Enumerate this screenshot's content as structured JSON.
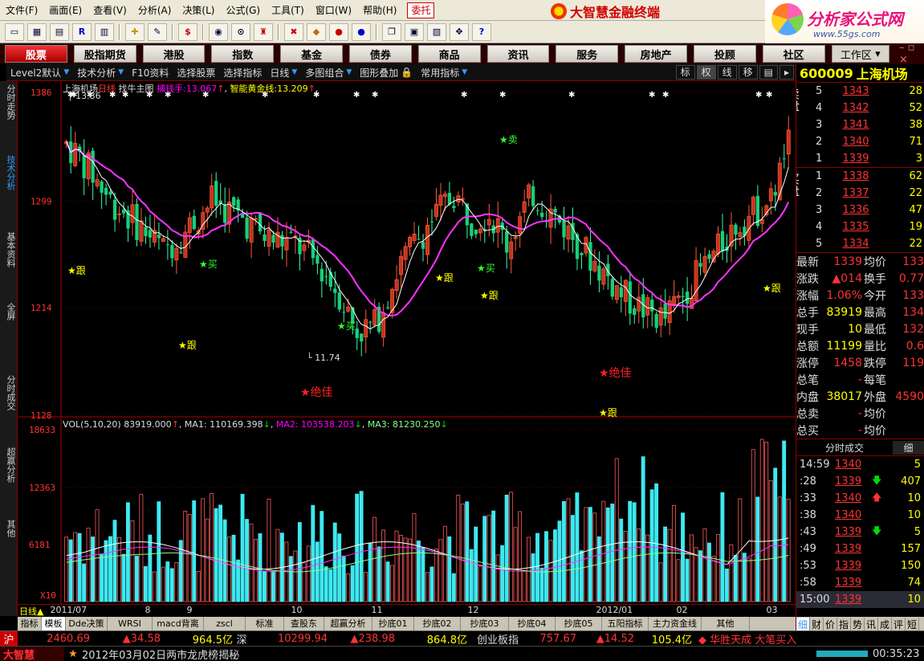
{
  "menu": [
    "文件(F)",
    "画面(E)",
    "查看(V)",
    "分析(A)",
    "决策(L)",
    "公式(G)",
    "工具(T)",
    "窗口(W)",
    "帮助(H)"
  ],
  "weituo": "委托",
  "brand": "大智慧金融终端",
  "site_logo": {
    "title": "分析家公式网",
    "url": "www.55gs.com"
  },
  "categories": [
    "股票",
    "股指期货",
    "港股",
    "指数",
    "基金",
    "债券",
    "商品",
    "资讯",
    "服务",
    "房地产",
    "投顾",
    "社区"
  ],
  "work_zone": "工作区",
  "subbar": {
    "items": [
      "Level2默认",
      "技术分析",
      "F10资料",
      "选择股票",
      "选择指标",
      "日线",
      "多图组合",
      "图形叠加",
      "常用指标"
    ],
    "right_buttons": [
      "标",
      "权",
      "线",
      "移"
    ]
  },
  "left_tabs": [
    "分时走势",
    "技术分析",
    "基本资料",
    "全屏",
    "分时成交",
    "超赢分析",
    "其他"
  ],
  "main_legend": {
    "prefix": "上海机场",
    "period": "日线",
    "indicator": "找牛主图",
    "line1_label": "捕钱手:",
    "line1_value": "13.067",
    "line2_label": "智能黄金线:",
    "line2_value": "13.209"
  },
  "vol_legend": {
    "label": "VOL(5,10,20)",
    "value": "83919.000",
    "ma1": "MA1: 110169.398",
    "ma2": "MA2: 103538.203",
    "ma3": "MA3: 81230.250"
  },
  "annotations": {
    "high": "13.86",
    "low": "11.74",
    "follow": "跟",
    "buy": "买",
    "sell": "卖",
    "best": "绝佳"
  },
  "price_axis": [
    "1386",
    "1299",
    "1214",
    "1128"
  ],
  "vol_axis": [
    "18633",
    "12363",
    "6181"
  ],
  "vol_unit": "X10",
  "months": [
    "2011/07",
    "8",
    "9",
    "10",
    "11",
    "12",
    "2012/01",
    "02",
    "03"
  ],
  "day_label": "日线",
  "indicator_tabs": [
    "指标",
    "模板",
    "Dde决策",
    "WRSI",
    "macd背离",
    "zscl",
    "标准",
    "查股东",
    "超赢分析",
    "抄底01",
    "抄底02",
    "抄底03",
    "抄底04",
    "抄底05",
    "五阳指标",
    "主力资金线",
    "其他"
  ],
  "stock": {
    "code": "600009",
    "name": "上海机场"
  },
  "sell_label": "卖盘",
  "buy_label": "买盘",
  "asks": [
    {
      "level": "5",
      "price": "1343",
      "vol": "28"
    },
    {
      "level": "4",
      "price": "1342",
      "vol": "52"
    },
    {
      "level": "3",
      "price": "1341",
      "vol": "38"
    },
    {
      "level": "2",
      "price": "1340",
      "vol": "71"
    },
    {
      "level": "1",
      "price": "1339",
      "vol": "3"
    }
  ],
  "bids": [
    {
      "level": "1",
      "price": "1338",
      "vol": "62"
    },
    {
      "level": "2",
      "price": "1337",
      "vol": "22"
    },
    {
      "level": "3",
      "price": "1336",
      "vol": "47"
    },
    {
      "level": "4",
      "price": "1335",
      "vol": "19"
    },
    {
      "level": "5",
      "price": "1334",
      "vol": "22"
    }
  ],
  "quote": [
    [
      "最新",
      "1339",
      "均价",
      "133"
    ],
    [
      "涨跌",
      "▲014",
      "换手",
      "0.77"
    ],
    [
      "涨幅",
      "1.06%",
      "今开",
      "133"
    ],
    [
      "总手",
      "83919",
      "最高",
      "134"
    ],
    [
      "现手",
      "10",
      "最低",
      "132"
    ],
    [
      "总额",
      "11199",
      "量比",
      "0.6"
    ],
    [
      "涨停",
      "1458",
      "跌停",
      "119"
    ],
    [
      "总笔",
      "-",
      "每笔",
      ""
    ],
    [
      "内盘",
      "38017",
      "外盘",
      "4590"
    ],
    [
      "总卖",
      "-",
      "均价",
      ""
    ],
    [
      "总买",
      "-",
      "均价",
      ""
    ]
  ],
  "tick_header": [
    "分时成交",
    "细"
  ],
  "ticks": [
    {
      "time": "14:59",
      "price": "1340",
      "arrow": "",
      "vol": "5"
    },
    {
      "time": ":28",
      "price": "1339",
      "arrow": "down",
      "vol": "407"
    },
    {
      "time": ":33",
      "price": "1340",
      "arrow": "up",
      "vol": "10"
    },
    {
      "time": ":38",
      "price": "1340",
      "arrow": "",
      "vol": "10"
    },
    {
      "time": ":43",
      "price": "1339",
      "arrow": "down",
      "vol": "5"
    },
    {
      "time": ":49",
      "price": "1339",
      "arrow": "",
      "vol": "157"
    },
    {
      "time": ":53",
      "price": "1339",
      "arrow": "",
      "vol": "150"
    },
    {
      "time": ":58",
      "price": "1339",
      "arrow": "",
      "vol": "74"
    },
    {
      "time": "15:00",
      "price": "1339",
      "arrow": "",
      "vol": "10"
    }
  ],
  "right_tabs": [
    "细",
    "财",
    "价",
    "指",
    "势",
    "讯",
    "成",
    "评",
    "短"
  ],
  "status": {
    "sh_label": "沪",
    "sh_index": "2460.69",
    "sh_change": "▲34.58",
    "sh_amount": "964.5亿",
    "sz_label": "深",
    "sz_index": "10299.94",
    "sz_change": "▲238.98",
    "sz_amount": "864.8亿",
    "cyb_label": "创业板指",
    "cyb_index": "757.67",
    "cyb_change": "▲14.52",
    "cyb_amount": "105.4亿",
    "news": "◆ 华胜天成 大笔买入"
  },
  "status2": {
    "logo": "大智慧",
    "ticker": "2012年03月02日两市龙虎榜揭秘",
    "time": "00:35:23"
  },
  "colors": {
    "up": "#ff3333",
    "down": "#00ffff",
    "bg": "#000000",
    "accent": "#ffff00",
    "ma_magenta": "#ff00ff"
  }
}
